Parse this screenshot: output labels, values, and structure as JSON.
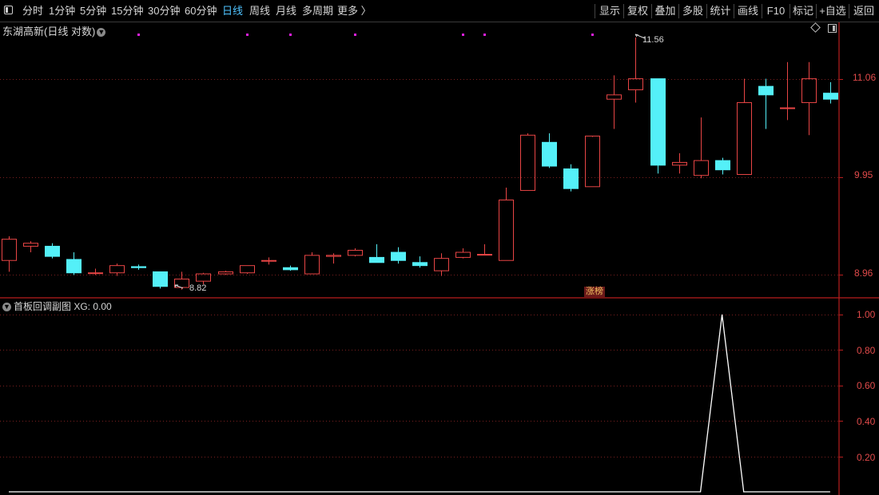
{
  "toolbar": {
    "left": [
      "分时",
      "1分钟",
      "5分钟",
      "15分钟",
      "30分钟",
      "60分钟",
      "日线",
      "周线",
      "月线",
      "多周期",
      "更多 〉"
    ],
    "active": "日线",
    "right": [
      "显示",
      "复权",
      "叠加",
      "多股",
      "统计",
      "画线",
      "F10",
      "标记",
      "+自选",
      "返回"
    ]
  },
  "chart_title": "东湖高新(日线 对数)",
  "indicator_title": "首板回调副图 XG: 0.00",
  "price_axis": [
    "11.06",
    "9.95",
    "8.96"
  ],
  "indicator_axis": [
    "1.00",
    "0.80",
    "0.60",
    "0.40",
    "0.20"
  ],
  "annotations": {
    "high": "11.56",
    "low": "8.82",
    "zhangbang": "涨榜"
  },
  "colors": {
    "up": "#e84545",
    "down": "#54f0f8",
    "grid": "#7a1f1f",
    "axis": "#b81e1e"
  },
  "chart_data": {
    "type": "candlestick",
    "ylim": [
      8.75,
      11.75
    ],
    "candles": [
      {
        "o": 9.1,
        "h": 9.34,
        "l": 8.99,
        "c": 9.31
      },
      {
        "o": 9.24,
        "h": 9.29,
        "l": 9.18,
        "c": 9.27
      },
      {
        "o": 9.24,
        "h": 9.27,
        "l": 9.12,
        "c": 9.14
      },
      {
        "o": 9.11,
        "h": 9.18,
        "l": 8.96,
        "c": 8.98
      },
      {
        "o": 8.98,
        "h": 9.02,
        "l": 8.96,
        "c": 8.98
      },
      {
        "o": 8.98,
        "h": 9.07,
        "l": 8.95,
        "c": 9.05
      },
      {
        "o": 9.04,
        "h": 9.06,
        "l": 9.01,
        "c": 9.03
      },
      {
        "o": 8.99,
        "h": 8.99,
        "l": 8.83,
        "c": 8.85
      },
      {
        "o": 8.84,
        "h": 8.99,
        "l": 8.82,
        "c": 8.92
      },
      {
        "o": 8.9,
        "h": 8.98,
        "l": 8.87,
        "c": 8.97
      },
      {
        "o": 8.97,
        "h": 9.0,
        "l": 8.96,
        "c": 8.99
      },
      {
        "o": 8.98,
        "h": 9.05,
        "l": 8.97,
        "c": 9.05
      },
      {
        "o": 9.1,
        "h": 9.13,
        "l": 9.06,
        "c": 9.1
      },
      {
        "o": 9.03,
        "h": 9.05,
        "l": 9.0,
        "c": 9.01
      },
      {
        "o": 8.97,
        "h": 9.18,
        "l": 8.97,
        "c": 9.15
      },
      {
        "o": 9.14,
        "h": 9.17,
        "l": 9.07,
        "c": 9.15
      },
      {
        "o": 9.15,
        "h": 9.22,
        "l": 9.14,
        "c": 9.2
      },
      {
        "o": 9.13,
        "h": 9.26,
        "l": 9.08,
        "c": 9.08
      },
      {
        "o": 9.18,
        "h": 9.23,
        "l": 9.07,
        "c": 9.1
      },
      {
        "o": 9.08,
        "h": 9.14,
        "l": 9.03,
        "c": 9.05
      },
      {
        "o": 9.0,
        "h": 9.17,
        "l": 8.95,
        "c": 9.12
      },
      {
        "o": 9.13,
        "h": 9.22,
        "l": 9.12,
        "c": 9.18
      },
      {
        "o": 9.16,
        "h": 9.26,
        "l": 9.15,
        "c": 9.16
      },
      {
        "o": 9.1,
        "h": 9.84,
        "l": 9.1,
        "c": 9.71
      },
      {
        "o": 9.81,
        "h": 10.43,
        "l": 9.81,
        "c": 10.41
      },
      {
        "o": 10.33,
        "h": 10.43,
        "l": 10.05,
        "c": 10.07
      },
      {
        "o": 10.04,
        "h": 10.09,
        "l": 9.8,
        "c": 9.83
      },
      {
        "o": 9.85,
        "h": 10.39,
        "l": 9.85,
        "c": 10.4
      },
      {
        "o": 10.82,
        "h": 11.1,
        "l": 10.48,
        "c": 10.87
      },
      {
        "o": 10.93,
        "h": 11.56,
        "l": 10.78,
        "c": 11.06
      },
      {
        "o": 11.06,
        "h": 11.06,
        "l": 9.99,
        "c": 10.08
      },
      {
        "o": 10.08,
        "h": 10.21,
        "l": 9.99,
        "c": 10.11
      },
      {
        "o": 9.97,
        "h": 10.61,
        "l": 9.94,
        "c": 10.13
      },
      {
        "o": 10.13,
        "h": 10.16,
        "l": 9.98,
        "c": 10.03
      },
      {
        "o": 9.98,
        "h": 11.06,
        "l": 9.98,
        "c": 10.78
      },
      {
        "o": 10.97,
        "h": 11.06,
        "l": 10.48,
        "c": 10.87
      },
      {
        "o": 10.72,
        "h": 11.26,
        "l": 10.58,
        "c": 10.72
      },
      {
        "o": 10.78,
        "h": 11.26,
        "l": 10.41,
        "c": 11.06
      },
      {
        "o": 10.89,
        "h": 11.02,
        "l": 10.77,
        "c": 10.82
      }
    ],
    "xg_signal": [
      0,
      0,
      0,
      0,
      0,
      0,
      0,
      0,
      0,
      0,
      0,
      0,
      0,
      0,
      0,
      0,
      0,
      0,
      0,
      0,
      0,
      0,
      0,
      0,
      0,
      0,
      0,
      0,
      0,
      0,
      0,
      0,
      0,
      1,
      0,
      0,
      0,
      0,
      0
    ],
    "markers": [
      6,
      11,
      13,
      16,
      21,
      22,
      27
    ]
  }
}
